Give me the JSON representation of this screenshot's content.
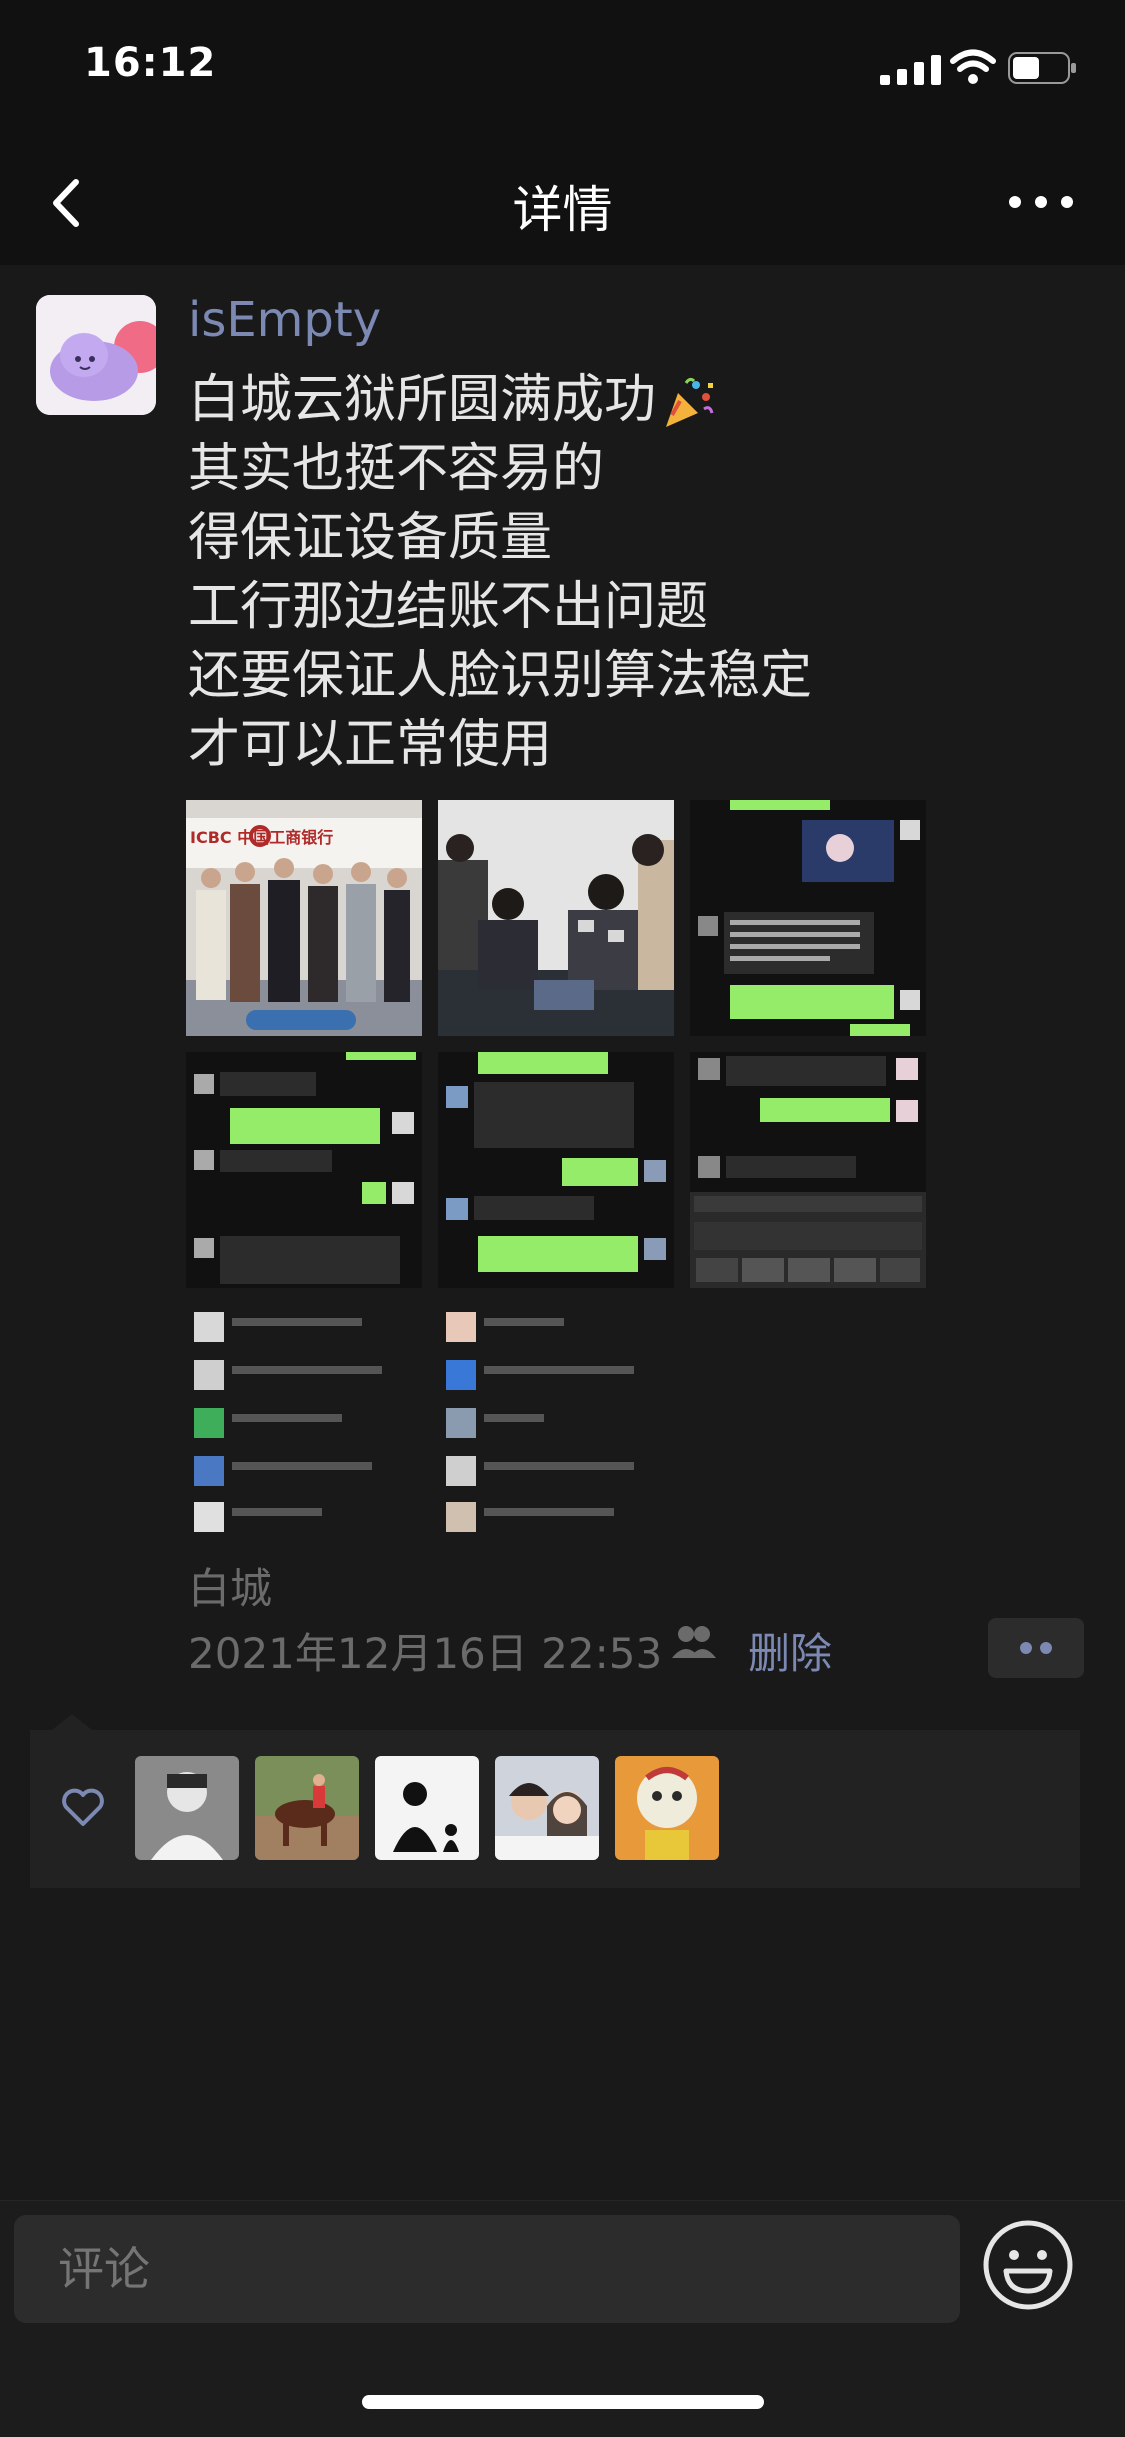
{
  "status_bar": {
    "time": "16:12"
  },
  "nav": {
    "title": "详情"
  },
  "post": {
    "username": "isEmpty",
    "lines": [
      "白城云狱所圆满成功",
      "其实也挺不容易的",
      "得保证设备质量",
      "工行那边结账不出问题",
      "还要保证人脸识别算法稳定",
      "才可以正常使用"
    ],
    "photo_captions": [
      "ICBC 中国工商银行"
    ],
    "location": "白城",
    "date": "2021年12月16日 22:53",
    "delete_label": "删除"
  },
  "comment": {
    "placeholder": "评论"
  },
  "colors": {
    "link": "#7c89b3",
    "background": "#191919",
    "chat_bubble": "#95ec69"
  }
}
